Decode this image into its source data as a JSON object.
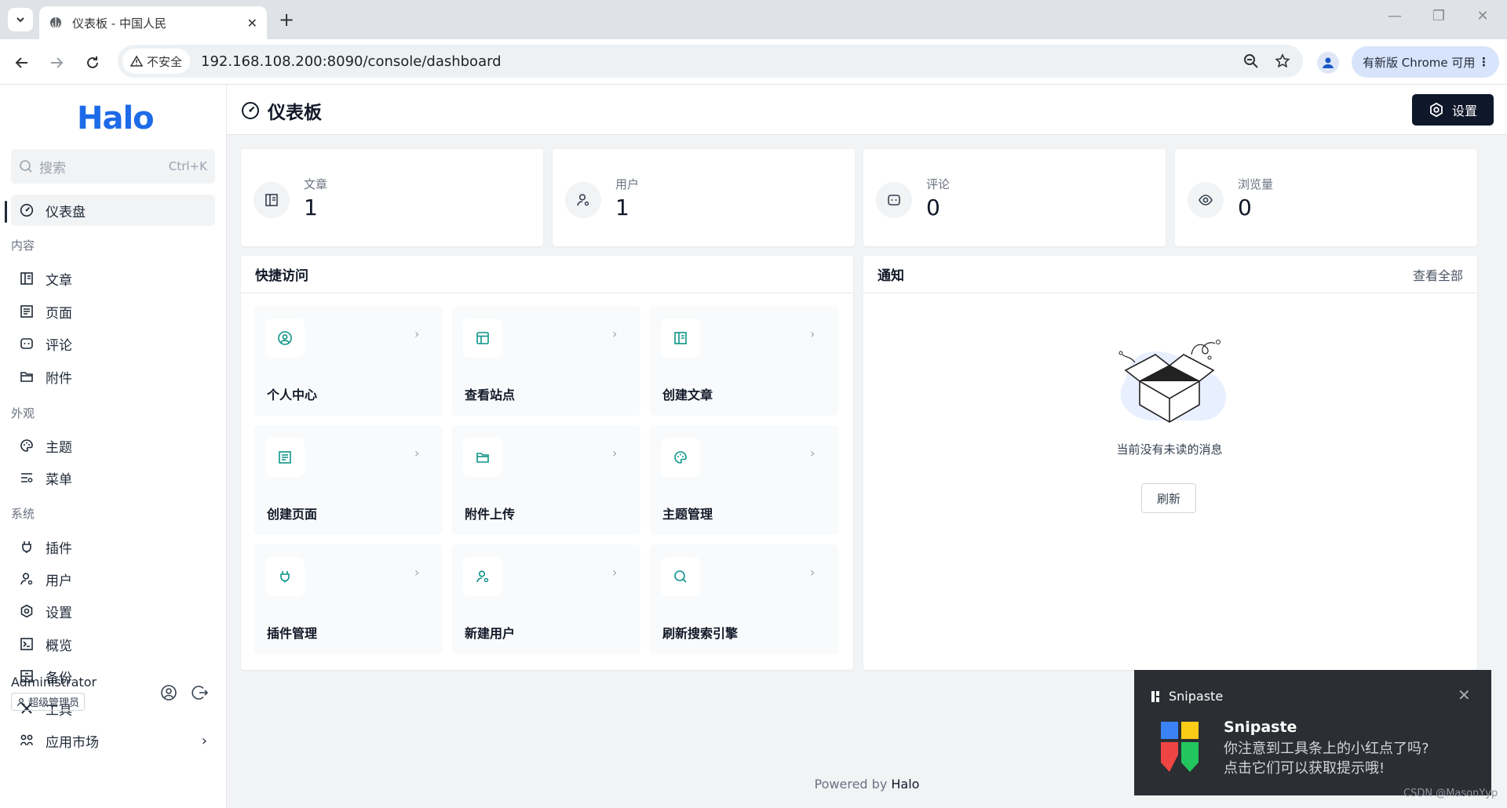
{
  "browser": {
    "tab_title": "仪表板 - 中国人民",
    "insecure_label": "不安全",
    "url": "192.168.108.200:8090/console/dashboard",
    "update_label": "有新版 Chrome 可用"
  },
  "sidebar": {
    "logo": "Halo",
    "search_placeholder": "搜索",
    "search_shortcut": "Ctrl+K",
    "dashboard": "仪表盘",
    "groups": {
      "content": "内容",
      "appearance": "外观",
      "system": "系统"
    },
    "items": {
      "posts": "文章",
      "pages": "页面",
      "comments": "评论",
      "attachments": "附件",
      "themes": "主题",
      "menus": "菜单",
      "plugins": "插件",
      "users": "用户",
      "settings": "设置",
      "overview": "概览",
      "backup": "备份",
      "tools": "工具",
      "app_market": "应用市场"
    },
    "user": {
      "name": "Administrator",
      "role": "超级管理员"
    }
  },
  "header": {
    "title": "仪表板",
    "settings_button": "设置"
  },
  "stats": [
    {
      "label": "文章",
      "value": "1"
    },
    {
      "label": "用户",
      "value": "1"
    },
    {
      "label": "评论",
      "value": "0"
    },
    {
      "label": "浏览量",
      "value": "0"
    }
  ],
  "quick_access": {
    "title": "快捷访问",
    "items": [
      "个人中心",
      "查看站点",
      "创建文章",
      "创建页面",
      "附件上传",
      "主题管理",
      "插件管理",
      "新建用户",
      "刷新搜索引擎"
    ]
  },
  "notifications": {
    "title": "通知",
    "view_all": "查看全部",
    "empty_text": "当前没有未读的消息",
    "refresh": "刷新"
  },
  "footer": {
    "prefix": "Powered by",
    "brand": "Halo"
  },
  "toast": {
    "app": "Snipaste",
    "title": "Snipaste",
    "line1": "你注意到工具条上的小红点了吗?",
    "line2": "点击它们可以获取提示哦!"
  },
  "watermark": "CSDN @MasonYyp",
  "colors": {
    "accent": "#1d6be8",
    "teal": "#0d9488",
    "dark_button": "#0f172a"
  }
}
